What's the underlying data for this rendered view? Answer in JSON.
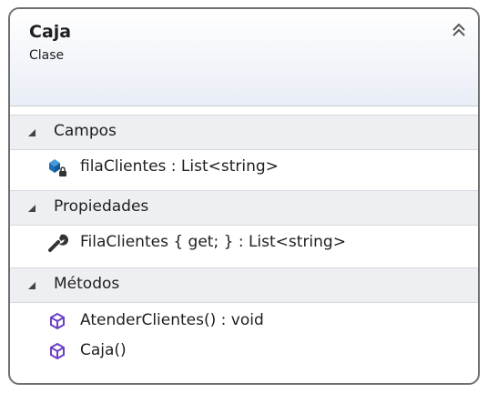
{
  "class_box": {
    "title": "Caja",
    "subtitle": "Clase",
    "collapse_icon": "double-chevron-up-icon",
    "sections": {
      "campos": {
        "label": "Campos",
        "members": [
          {
            "text": "filaClientes : List<string>",
            "icon": "private-field-icon"
          }
        ]
      },
      "propiedades": {
        "label": "Propiedades",
        "members": [
          {
            "text": "FilaClientes { get; } : List<string>",
            "icon": "property-wrench-icon"
          }
        ]
      },
      "metodos": {
        "label": "Métodos",
        "members": [
          {
            "text": "AtenderClientes() : void",
            "icon": "method-cube-icon"
          },
          {
            "text": "Caja()",
            "icon": "method-cube-icon"
          }
        ]
      }
    }
  },
  "colors": {
    "border": "#6f6f6f",
    "header_gradient_end": "#e9edf6",
    "section_bg": "#eeeff3",
    "field_icon": "#1c6fb8",
    "method_icon": "#6c3fc4"
  }
}
